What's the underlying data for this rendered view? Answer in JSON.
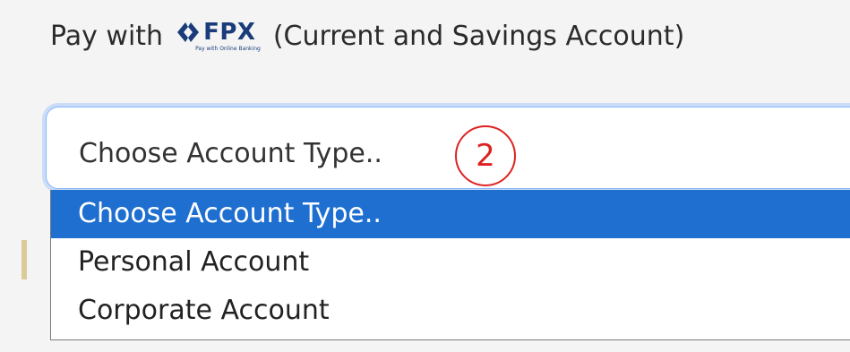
{
  "pay_line": {
    "prefix": "Pay with",
    "fpx_brand": "FPX",
    "fpx_tagline": "Pay with Online Banking",
    "suffix": "(Current and Savings Account)"
  },
  "select": {
    "current_value": "Choose Account Type..",
    "options": [
      {
        "label": "Choose Account Type..",
        "selected": true
      },
      {
        "label": "Personal Account",
        "selected": false
      },
      {
        "label": "Corporate Account",
        "selected": false
      }
    ]
  },
  "annotation": {
    "number": "2"
  },
  "colors": {
    "brand": "#1a3c7a",
    "selected_option": "#1f6fd1",
    "focus_ring": "#86b7fe",
    "annotation": "#dd2222"
  },
  "icons": {
    "fpx_logo": "fpx-logo-icon"
  }
}
